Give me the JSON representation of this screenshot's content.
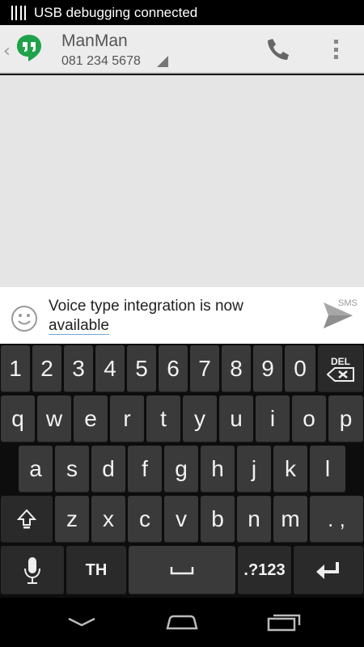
{
  "status_bar": {
    "notification": "USB debugging connected"
  },
  "header": {
    "contact_name": "ManMan",
    "contact_number": "081 234 5678",
    "icons": [
      "back-chevron-icon",
      "hangouts-logo-icon",
      "phone-icon",
      "overflow-menu-icon"
    ]
  },
  "compose": {
    "message_line1": "Voice type integration is now",
    "message_line2": "available",
    "send_mode": "SMS",
    "icons": [
      "emoji-icon",
      "send-icon"
    ]
  },
  "keyboard": {
    "row_numbers": [
      "1",
      "2",
      "3",
      "4",
      "5",
      "6",
      "7",
      "8",
      "9",
      "0"
    ],
    "delete_label": "DEL",
    "row_top": [
      "q",
      "w",
      "e",
      "r",
      "t",
      "y",
      "u",
      "i",
      "o",
      "p"
    ],
    "row_home": [
      "a",
      "s",
      "d",
      "f",
      "g",
      "h",
      "j",
      "k",
      "l"
    ],
    "row_bottom": [
      "z",
      "x",
      "c",
      "v",
      "b",
      "n",
      "m"
    ],
    "punctuation": ". ,",
    "language": "TH",
    "symbols": ".?123",
    "icons": [
      "delete-icon",
      "shift-icon",
      "microphone-icon",
      "space-icon",
      "enter-icon"
    ]
  },
  "colors": {
    "action_bar": "#ececec",
    "conversation": "#e5e5e5",
    "key": "#3a3a3a",
    "keyboard_bg": "#0d0d0d",
    "hangouts_green": "#1fa24a"
  },
  "navigation": {
    "icons": [
      "back-icon",
      "home-icon",
      "recents-icon"
    ]
  }
}
